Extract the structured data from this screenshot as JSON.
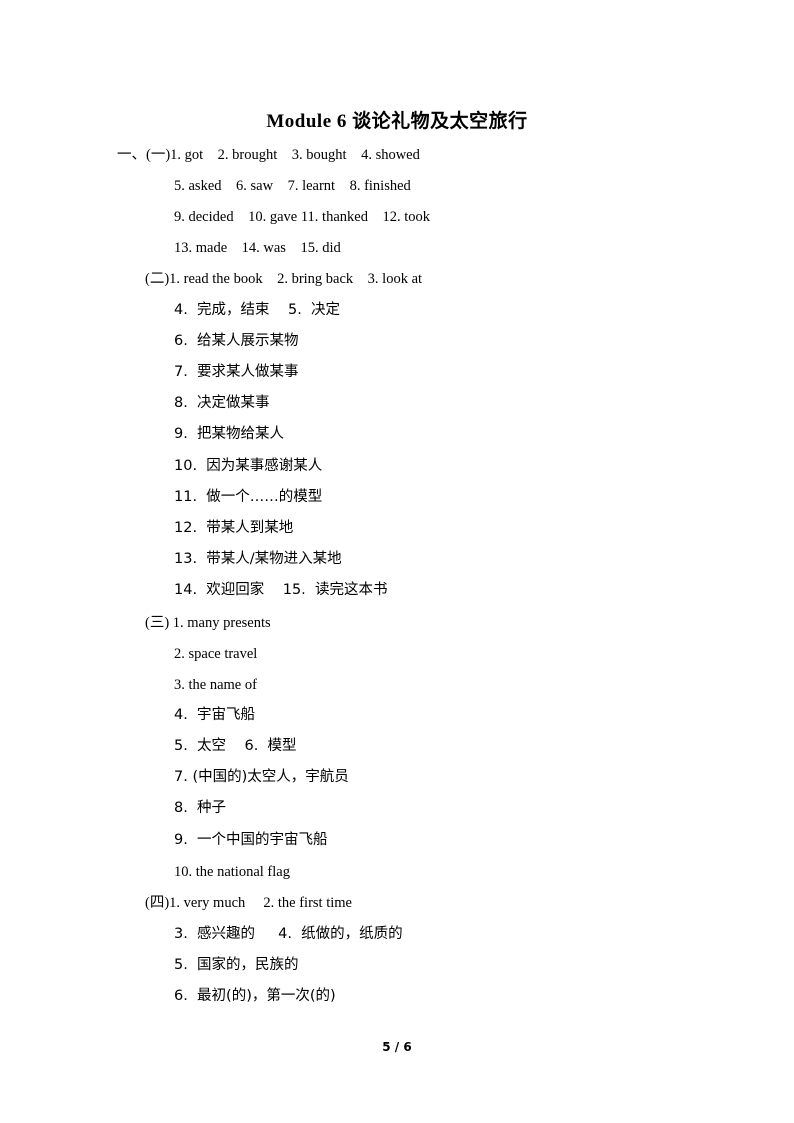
{
  "title": "Module 6 谈论礼物及太空旅行",
  "lines": [
    {
      "text": "一、(一)1. got    2. brought    3. bought    4. showed"
    },
    {
      "text": "5. asked    6. saw    7. learnt    8. finished"
    },
    {
      "text": "9. decided    10. gave 11. thanked    12. took"
    },
    {
      "text": "13. made    14. was    15. did"
    },
    {
      "text": "(二)1. read the book    2. bring back    3. look at"
    },
    {
      "text": "4.  完成，结束    5.  决定"
    },
    {
      "text": "6.  给某人展示某物"
    },
    {
      "text": "7.  要求某人做某事"
    },
    {
      "text": "8.  决定做某事"
    },
    {
      "text": "9.  把某物给某人"
    },
    {
      "text": "10.  因为某事感谢某人"
    },
    {
      "text": "11.  做一个……的模型"
    },
    {
      "text": "12.  带某人到某地"
    },
    {
      "text": "13.  带某人/某物进入某地"
    },
    {
      "text": "14.  欢迎回家    15.  读完这本书"
    },
    {
      "text": "(三) 1. many presents"
    },
    {
      "text": "2. space travel"
    },
    {
      "text": "3. the name of"
    },
    {
      "text": "4.  宇宙飞船"
    },
    {
      "text": "5.  太空    6.  模型"
    },
    {
      "text": "7. (中国的)太空人，宇航员"
    },
    {
      "text": "8.  种子"
    },
    {
      "text": "9.  一个中国的宇宙飞船"
    },
    {
      "text": "10. the national flag"
    },
    {
      "text": "(四)1. very much     2. the first time"
    },
    {
      "text": "3.  感兴趣的     4.  纸做的，纸质的"
    },
    {
      "text": "5.  国家的，民族的"
    },
    {
      "text": "6.  最初(的)，第一次(的)"
    }
  ],
  "footer": {
    "page": "5 / 6"
  }
}
